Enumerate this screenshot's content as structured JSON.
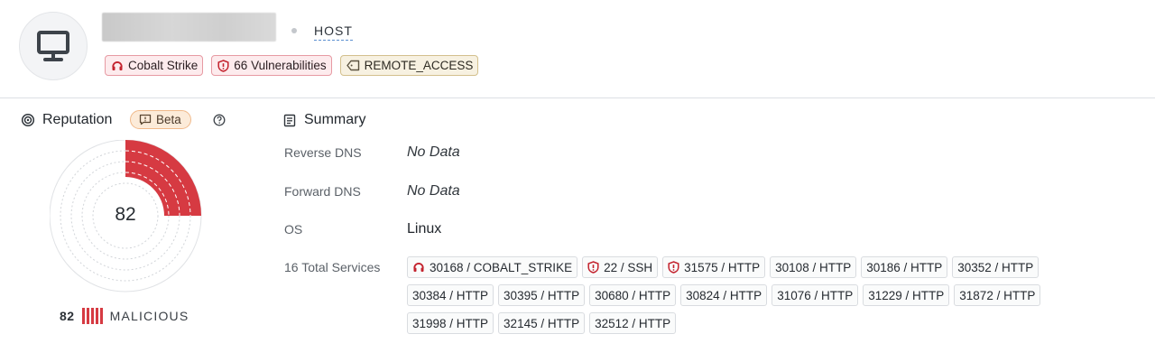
{
  "header": {
    "type_label": "HOST",
    "tags": [
      {
        "label": "Cobalt Strike",
        "icon": "cobalt-strike-icon",
        "style": "red"
      },
      {
        "label": "66 Vulnerabilities",
        "icon": "shield-icon",
        "style": "red"
      },
      {
        "label": "REMOTE_ACCESS",
        "icon": "tag-icon",
        "style": "tan"
      }
    ]
  },
  "reputation": {
    "title": "Reputation",
    "beta_label": "Beta",
    "score": "82",
    "score_fraction": 0.25,
    "verdict": "MALICIOUS"
  },
  "summary": {
    "title": "Summary",
    "rows": [
      {
        "label": "Reverse DNS",
        "value": "No Data"
      },
      {
        "label": "Forward DNS",
        "value": "No Data"
      },
      {
        "label": "OS",
        "value": "Linux"
      }
    ],
    "services_label": "16 Total Services",
    "services": [
      {
        "label": "30168 / COBALT_STRIKE",
        "icon": "cobalt-strike-icon"
      },
      {
        "label": "22 / SSH",
        "icon": "shield-icon"
      },
      {
        "label": "31575 / HTTP",
        "icon": "shield-icon"
      },
      {
        "label": "30108 / HTTP",
        "icon": ""
      },
      {
        "label": "30186 / HTTP",
        "icon": ""
      },
      {
        "label": "30352 / HTTP",
        "icon": ""
      },
      {
        "label": "30384 / HTTP",
        "icon": ""
      },
      {
        "label": "30395 / HTTP",
        "icon": ""
      },
      {
        "label": "30680 / HTTP",
        "icon": ""
      },
      {
        "label": "30824 / HTTP",
        "icon": ""
      },
      {
        "label": "31076 / HTTP",
        "icon": ""
      },
      {
        "label": "31229 / HTTP",
        "icon": ""
      },
      {
        "label": "31872 / HTTP",
        "icon": ""
      },
      {
        "label": "31998 / HTTP",
        "icon": ""
      },
      {
        "label": "32145 / HTTP",
        "icon": ""
      },
      {
        "label": "32512 / HTTP",
        "icon": ""
      }
    ]
  },
  "colors": {
    "malicious_red": "#d63a42",
    "tag_red_bg": "#fdebed",
    "tag_tan_bg": "#f7f1e1",
    "beta_bg": "#fcebd9"
  }
}
